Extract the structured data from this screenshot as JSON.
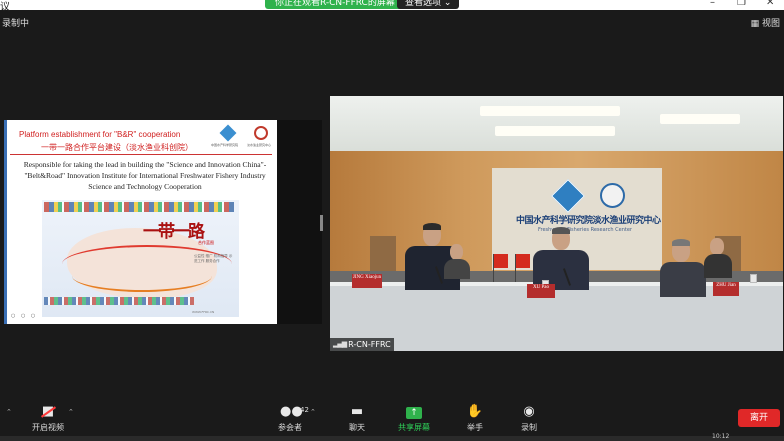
{
  "window": {
    "app_name_fragment": "议",
    "controls": [
      "–",
      "❐",
      "✕"
    ]
  },
  "share_banner": {
    "text": "你正在观看R-CN-FFRC的屏幕",
    "view_options": "查看选项 ⌄"
  },
  "recording_label": "录制中",
  "view_toggle": "▦ 视图",
  "slide": {
    "title_en": "Platform establishment for \"B&R\" cooperation",
    "title_cn": "一带一路合作平台建设（淡水渔业科创院）",
    "logo_left_caption": "中国水产科学研究院",
    "logo_right_caption": "淡水渔业研究中心",
    "body": "Responsible for taking the lead in building the \"Science and Innovation China\"-\"Belt&Road\" Innovation Institute for International Freshwater Fishery Industry Science and Technology Cooperation",
    "map_title": "一带一路",
    "map_subtitle": "合作蓝图",
    "map_notes": "公益性·推广 机构指导 示范工作 服务合作",
    "map_footer": "WWW.FFRC.CN",
    "nav_dots": "○ ○ ○"
  },
  "video": {
    "wall_sign": "中国水产科学研究院淡水渔业研究中心",
    "wall_sign_sub": "Freshwater Fisheries Research Center",
    "nameplates": [
      "JING Xiaojun",
      "XU Pao",
      "ZHU Jian"
    ],
    "participant_label": "R-CN-FFRC",
    "signal_icon": "signal-bars-icon"
  },
  "toolbar": {
    "audio_caret": "⌃",
    "video_label": "开启视频",
    "participants_label": "参会者",
    "participants_count": "42",
    "chat_label": "聊天",
    "share_label": "共享屏幕",
    "raise_hand_label": "举手",
    "record_label": "录制",
    "leave_label": "离开"
  },
  "clock_fragment": "10:12",
  "colors": {
    "share_green": "#2fb24c",
    "leave_red": "#e02828",
    "slide_title_red": "#d02020"
  }
}
